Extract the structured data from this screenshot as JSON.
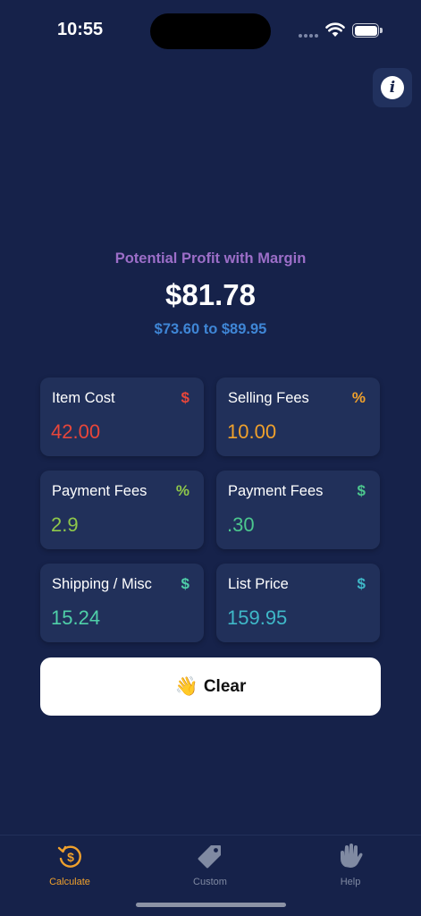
{
  "status_bar": {
    "time": "10:55"
  },
  "summary": {
    "label": "Potential Profit with Margin",
    "profit": "$81.78",
    "range": "$73.60 to $89.95"
  },
  "fields": [
    {
      "label": "Item Cost",
      "unit": "$",
      "value": "42.00",
      "unit_color": "#e8463a",
      "value_color": "#e8463a"
    },
    {
      "label": "Selling Fees",
      "unit": "%",
      "value": "10.00",
      "unit_color": "#f0a12c",
      "value_color": "#f0a12c"
    },
    {
      "label": "Payment Fees",
      "unit": "%",
      "value": "2.9",
      "unit_color": "#8fc84a",
      "value_color": "#8fc84a"
    },
    {
      "label": "Payment Fees",
      "unit": "$",
      "value": ".30",
      "unit_color": "#4cc78e",
      "value_color": "#4cc78e"
    },
    {
      "label": "Shipping / Misc",
      "unit": "$",
      "value": "15.24",
      "unit_color": "#4fcfa8",
      "value_color": "#4fcfa8"
    },
    {
      "label": "List Price",
      "unit": "$",
      "value": "159.95",
      "unit_color": "#3fb8c8",
      "value_color": "#3fb8c8"
    }
  ],
  "clear_button": {
    "emoji": "👋",
    "label": "Clear"
  },
  "tabs": [
    {
      "label": "Calculate",
      "icon": "dollar-refresh-icon",
      "active": true
    },
    {
      "label": "Custom",
      "icon": "tag-icon",
      "active": false
    },
    {
      "label": "Help",
      "icon": "waving-hand-icon",
      "active": false
    }
  ],
  "colors": {
    "background": "#16224a",
    "card": "#21305a",
    "accent_active": "#f0a12c",
    "inactive": "#808aa2",
    "summary_label": "#9c6ec8",
    "summary_range": "#3f86d6"
  }
}
